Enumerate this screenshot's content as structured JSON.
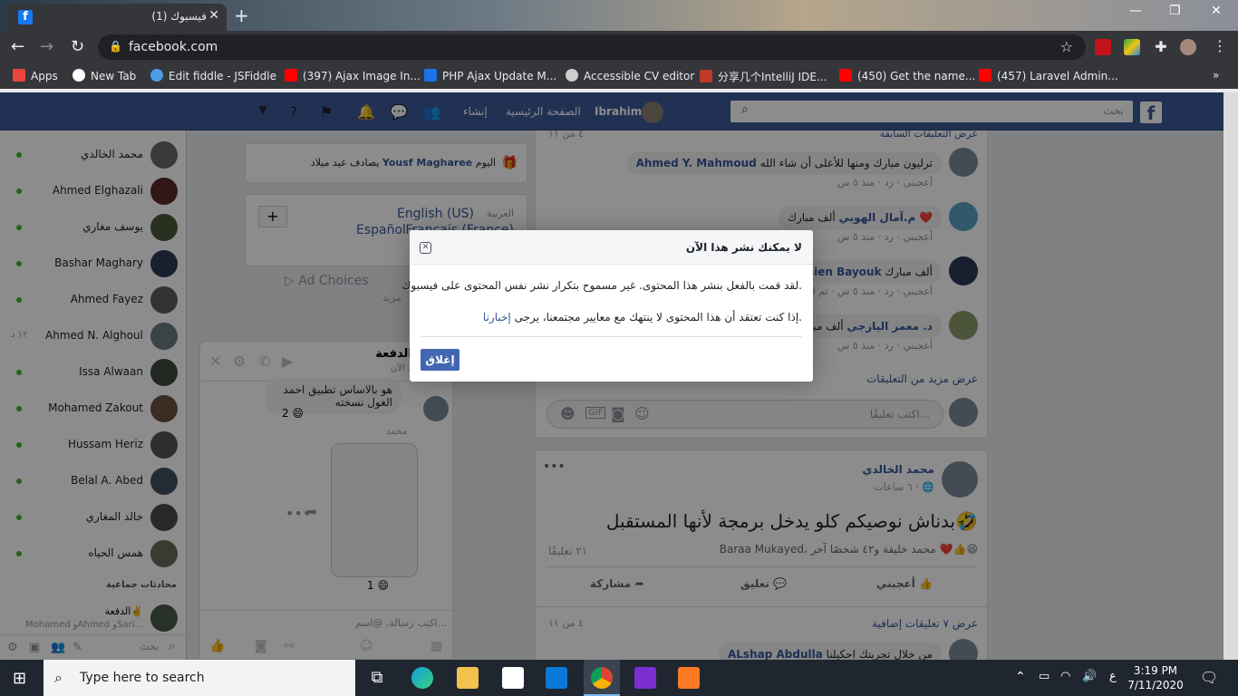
{
  "browser": {
    "tab_title": "(1) فيسبوك",
    "tab_favicon": "f",
    "tab_close": "✕",
    "new_tab": "+",
    "url": "facebook.com",
    "window_controls": [
      "—",
      "❐",
      "✕"
    ]
  },
  "bookmarks": [
    {
      "label": "Apps",
      "color": "#e8453c"
    },
    {
      "label": "New Tab",
      "color": "#ffffff"
    },
    {
      "label": "Edit fiddle - JSFiddle",
      "color": "#4b9be5"
    },
    {
      "label": "(397) Ajax Image In...",
      "color": "#ff0000"
    },
    {
      "label": "PHP Ajax Update M...",
      "color": "#1a73e8"
    },
    {
      "label": "Accessible CV editor",
      "color": "#cccccc"
    },
    {
      "label": "分享几个IntelliJ IDE...",
      "color": "#c0392b"
    },
    {
      "label": "(450) Get the name...",
      "color": "#ff0000"
    },
    {
      "label": "(457) Laravel Admin...",
      "color": "#ff0000"
    }
  ],
  "fb_header": {
    "search_placeholder": "بحث",
    "logo": "f",
    "user": "Ibrahim",
    "home": "الصفحة الرئيسية",
    "create": "إنشاء"
  },
  "chat_sidebar": {
    "contacts": [
      {
        "name": "محمد الخالدي",
        "time": ""
      },
      {
        "name": "Ahmed Elghazali",
        "time": ""
      },
      {
        "name": "يوسف مغاري",
        "time": ""
      },
      {
        "name": "Bashar Maghary",
        "time": ""
      },
      {
        "name": "Ahmed Fayez",
        "time": ""
      },
      {
        "name": "Ahmed N. Alghoul",
        "time": "١٢ د"
      },
      {
        "name": "Issa Alwaan",
        "time": ""
      },
      {
        "name": "Mohamed Zakout",
        "time": ""
      },
      {
        "name": "Hussam Heriz",
        "time": ""
      },
      {
        "name": "Belal A. Abed",
        "time": ""
      },
      {
        "name": "خالد المغاري",
        "time": ""
      },
      {
        "name": "همس الحياه",
        "time": ""
      }
    ],
    "group_header": "محادثات جماعية",
    "group_name": "الدفعة✌️",
    "group_members": "Mohamed وAhmed وSari...",
    "search_placeholder": "بحث"
  },
  "birthday": {
    "text_suffix": "اليوم",
    "name": "Yousf Magharee",
    "text_prefix": "يصادف عيد ميلاد"
  },
  "languages": {
    "lang1": "العربية",
    "lang2": "English (US)",
    "lang3": "Français (France)",
    "lang4": "Español",
    "plus": "+",
    "ad_choices": "Ad Choices",
    "more": "مزيد"
  },
  "chat_window": {
    "title": "الدفعة✌️",
    "subtitle": "نشط الآن",
    "msg1": "هو بالاساس تطبيق احمد الغول نسخته",
    "reaction1": "2",
    "sender": "محمد",
    "reaction2": "1",
    "input_placeholder": "اكتب رسالة، @اسم..."
  },
  "comments_top": {
    "prev_comments": "عرض التعليقات السابقة",
    "count": "٤ من ١١",
    "items": [
      {
        "author": "Ahmed Y. Mahmoud",
        "text": "ترليون مبارك ومنها للأعلى أن شاء الله",
        "meta": "أعجبني · رد · منذ ٥ س"
      },
      {
        "author": "م.آمال الهوبي",
        "text": "ألف مبارك ❤️",
        "meta": "أعجبني · رد · منذ ٥ س"
      },
      {
        "author": "Hussien Bayouk",
        "text": "ألف مبارك",
        "meta": "أعجبني · رد · منذ ٥ س · تم التعديل"
      },
      {
        "author": "د. معمر اليازجي",
        "text": "ألف مبروك",
        "meta": "أعجبني · رد · منذ ٥ س"
      }
    ],
    "more_comments": "عرض مزيد من التعليقات",
    "write_placeholder": "اكتب تعليقًا..."
  },
  "post": {
    "author": "محمد الخالدي",
    "time": "٦ ساعات",
    "menu": "•••",
    "text": "بدناش نوصيكم كلو يدخل برمجة لأنها المستقبل🤣",
    "reactions": "Baraa Mukayed، محمد خليفة و٤٢ شخصًا آخر",
    "comments_count": "٢١ تعليقًا",
    "like": "أعجبني",
    "comment": "تعليق",
    "share": "مشاركة",
    "more_comments": "عرض ٧ تعليقات إضافية",
    "more_count": "٤ من ١١",
    "next_author": "ALshap Abdulla",
    "next_text": "من خلال تجربتك احكيلنا"
  },
  "modal": {
    "title": "لا يمكنك نشر هذا الآن",
    "close_icon": "✕",
    "body1": "لقد قمت بالفعل بنشر هذا المحتوى. غير مسموح بتكرار نشر نفس المحتوى على فيسبوك.",
    "body2_prefix": "إذا كنت تعتقد أن هذا المحتوى لا ينتهك مع معايير مجتمعنا، يرجى ",
    "body2_link": "إخبارنا",
    "body2_suffix": ".",
    "button": "إغلاق"
  },
  "taskbar": {
    "search_placeholder": "Type here to search",
    "time": "3:19 PM",
    "date": "7/11/2020",
    "lang": "ع"
  }
}
